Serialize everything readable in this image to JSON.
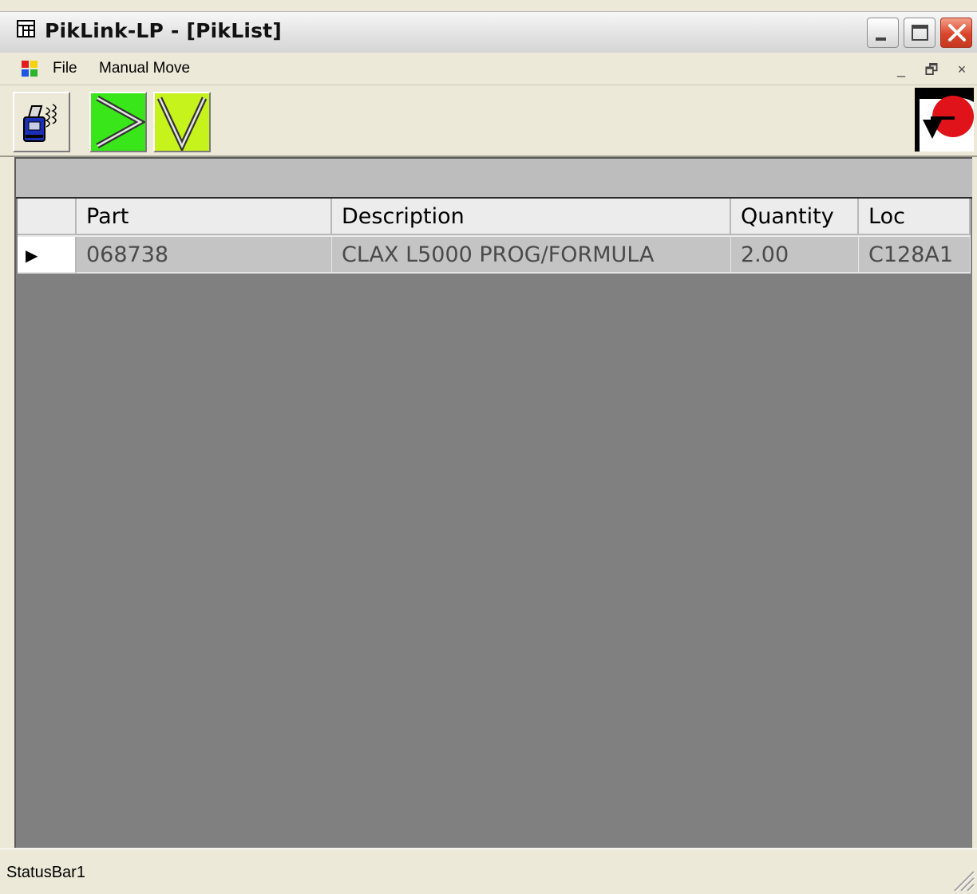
{
  "window": {
    "title": "PikLink-LP - [PikList]",
    "controls": {
      "minimize_icon": "minimize-icon",
      "maximize_icon": "maximize-icon",
      "close_icon": "close-icon"
    }
  },
  "menubar": {
    "app_icon": "mdi-child-icon",
    "items": [
      {
        "label": "File"
      },
      {
        "label": "Manual Move"
      }
    ],
    "mdi_minimize": "_",
    "mdi_restore": "🗗",
    "mdi_close": "×"
  },
  "toolbar": {
    "buttons": [
      {
        "icon": "handheld-scanner-icon",
        "color": "#ece9d8"
      },
      {
        "icon": "play-next-icon",
        "color": "#39e619"
      },
      {
        "icon": "down-triangle-icon",
        "color": "#c7f31c"
      }
    ],
    "logo_icon": "company-logo-icon",
    "logo_colors": [
      "#e0121a",
      "#000000",
      "#ffffff"
    ]
  },
  "grid": {
    "columns": [
      "",
      "Part",
      "Description",
      "Quantity",
      "Loc"
    ],
    "rows": [
      {
        "indicator": "▶",
        "part": "068738",
        "description": "CLAX L5000 PROG/FORMULA",
        "quantity": "2.00",
        "loc": "C128A1"
      }
    ]
  },
  "statusbar": {
    "text": "StatusBar1"
  }
}
